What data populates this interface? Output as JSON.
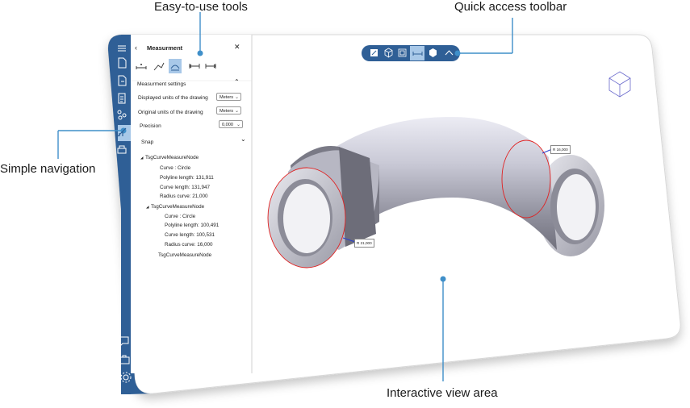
{
  "callouts": {
    "tools": "Easy-to-use tools",
    "toolbar": "Quick access toolbar",
    "navigation": "Simple navigation",
    "view": "Interactive view area"
  },
  "panel": {
    "title": "Measurment",
    "settings_header": "Measurment settings",
    "displayed_units_label": "Displayed units of the drawing",
    "displayed_units_value": "Meters",
    "original_units_label": "Original units of the drawing",
    "original_units_value": "Meters",
    "precision_label": "Precision",
    "precision_value": "0,000",
    "snap_label": "Snap"
  },
  "tree": [
    {
      "text": "TsgCurveMeasureNode",
      "level": 0,
      "expanded": true
    },
    {
      "text": "Curve : Circle",
      "level": 1
    },
    {
      "text": "Polyline length: 131,911",
      "level": 1
    },
    {
      "text": "Curve length: 131,947",
      "level": 1
    },
    {
      "text": "Radius curve: 21,000",
      "level": 1
    },
    {
      "text": "TsgCurveMeasureNode",
      "level": 0,
      "expanded": true
    },
    {
      "text": "Curve : Circle",
      "level": 1
    },
    {
      "text": "Polyline length: 100,491",
      "level": 1
    },
    {
      "text": "Curve length: 100,531",
      "level": 1
    },
    {
      "text": "Radius curve: 16,000",
      "level": 1
    },
    {
      "text": "TsgCurveMeasureNode",
      "level": 0
    }
  ],
  "labels": {
    "left_radius": "R 21,000",
    "right_radius": "R 16,000"
  },
  "colors": {
    "sidebar": "#2f5f96",
    "toolbar": "#2f5f96",
    "accent": "#3f8fc9",
    "highlight": "#a8c8e8",
    "measure_red": "#e02020"
  }
}
